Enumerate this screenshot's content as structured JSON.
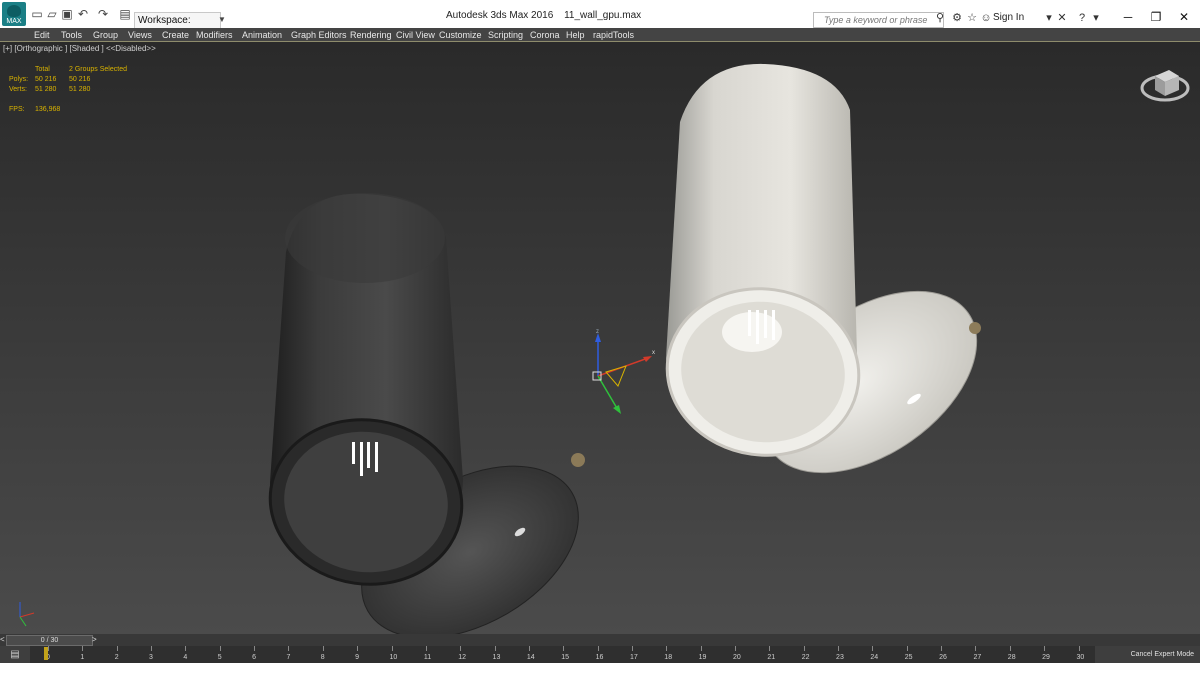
{
  "titlebar": {
    "logo_text": "MAX",
    "workspace": "Workspace: Default",
    "app_title": "Autodesk 3ds Max 2016",
    "file_name": "11_wall_gpu.max",
    "search_placeholder": "Type a keyword or phrase",
    "sign_in": "Sign In"
  },
  "menus": [
    "Edit",
    "Tools",
    "Group",
    "Views",
    "Create",
    "Modifiers",
    "Animation",
    "Graph Editors",
    "Rendering",
    "Civil View",
    "Customize",
    "Scripting",
    "Corona",
    "Help",
    "rapidTools"
  ],
  "viewport": {
    "label": "[+] [Orthographic ] [Shaded ]  <<Disabled>>",
    "stats": {
      "total": "Total",
      "groups": "2 Groups Selected",
      "polys_label": "Polys:",
      "polys_total": "50 216",
      "polys_sel": "50 216",
      "verts_label": "Verts:",
      "verts_total": "51 280",
      "verts_sel": "51 280",
      "fps_label": "FPS:",
      "fps_value": "136,968"
    },
    "gizmo": {
      "x": "x",
      "z": "z"
    }
  },
  "timeline": {
    "frame": "0 / 30",
    "prev": "<",
    "next": ">",
    "ticks": [
      "0",
      "1",
      "2",
      "3",
      "4",
      "5",
      "6",
      "7",
      "8",
      "9",
      "10",
      "11",
      "12",
      "13",
      "14",
      "15",
      "16",
      "17",
      "18",
      "19",
      "20",
      "21",
      "22",
      "23",
      "24",
      "25",
      "26",
      "27",
      "28",
      "29",
      "30"
    ],
    "cancel_expert": "Cancel Expert Mode"
  },
  "colors": {
    "menubar": "#444444",
    "viewport_top": "#2a2a2a",
    "viewport_bottom": "#4b4b4b",
    "stats": "#d9b300",
    "playhead": "#c2a21a"
  }
}
